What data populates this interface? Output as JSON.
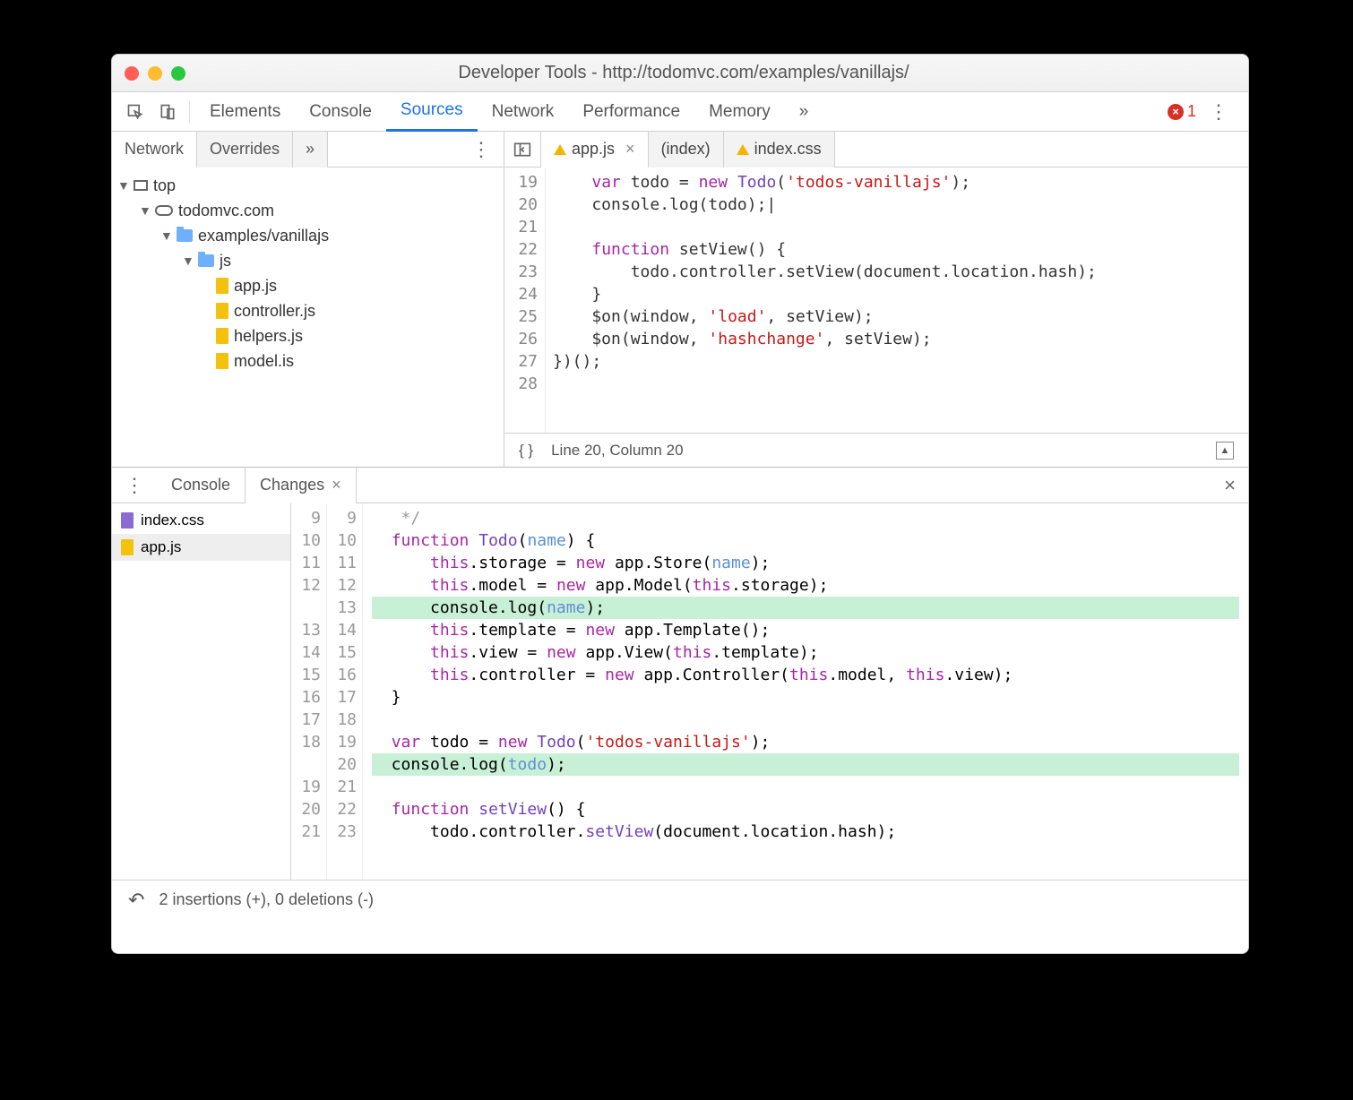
{
  "window": {
    "title": "Developer Tools - http://todomvc.com/examples/vanillajs/"
  },
  "toolbar": {
    "tabs": [
      "Elements",
      "Console",
      "Sources",
      "Network",
      "Performance",
      "Memory"
    ],
    "active": "Sources",
    "overflow": "»",
    "error_count": "1"
  },
  "left_panel": {
    "tabs": {
      "network": "Network",
      "overrides": "Overrides",
      "overflow": "»"
    },
    "tree": {
      "top": "top",
      "domain": "todomvc.com",
      "path": "examples/vanillajs",
      "js_folder": "js",
      "files": [
        "app.js",
        "controller.js",
        "helpers.js",
        "model.is"
      ]
    }
  },
  "editor": {
    "tabs": [
      {
        "name": "app.js",
        "warn": true,
        "close": true,
        "active": true
      },
      {
        "name": "(index)",
        "warn": false,
        "close": false,
        "active": false
      },
      {
        "name": "index.css",
        "warn": true,
        "close": false,
        "active": false
      }
    ],
    "lines": {
      "start": 19,
      "rows": [
        "    var todo = new Todo('todos-vanillajs');",
        "    console.log(todo);|",
        "",
        "    function setView() {",
        "        todo.controller.setView(document.location.hash);",
        "    }",
        "    $on(window, 'load', setView);",
        "    $on(window, 'hashchange', setView);",
        "})();",
        ""
      ]
    },
    "status": {
      "pretty": "{ }",
      "pos": "Line 20, Column 20"
    }
  },
  "drawer": {
    "tabs": {
      "console": "Console",
      "changes": "Changes"
    },
    "files": [
      {
        "name": "index.css",
        "type": "css"
      },
      {
        "name": "app.js",
        "type": "js",
        "selected": true
      }
    ],
    "diff": {
      "old_start": 9,
      "new_start": 9,
      "rows": [
        {
          "o": "9",
          "n": "9",
          "t": "   */",
          "added": false
        },
        {
          "o": "10",
          "n": "10",
          "t": "  function Todo(name) {",
          "added": false
        },
        {
          "o": "11",
          "n": "11",
          "t": "      this.storage = new app.Store(name);",
          "added": false
        },
        {
          "o": "12",
          "n": "12",
          "t": "      this.model = new app.Model(this.storage);",
          "added": false
        },
        {
          "o": "",
          "n": "13",
          "t": "      console.log(name);",
          "added": true
        },
        {
          "o": "13",
          "n": "14",
          "t": "      this.template = new app.Template();",
          "added": false
        },
        {
          "o": "14",
          "n": "15",
          "t": "      this.view = new app.View(this.template);",
          "added": false
        },
        {
          "o": "15",
          "n": "16",
          "t": "      this.controller = new app.Controller(this.model, this.view);",
          "added": false
        },
        {
          "o": "16",
          "n": "17",
          "t": "  }",
          "added": false
        },
        {
          "o": "17",
          "n": "18",
          "t": "",
          "added": false
        },
        {
          "o": "18",
          "n": "19",
          "t": "  var todo = new Todo('todos-vanillajs');",
          "added": false
        },
        {
          "o": "",
          "n": "20",
          "t": "  console.log(todo);",
          "added": true
        },
        {
          "o": "19",
          "n": "21",
          "t": "",
          "added": false
        },
        {
          "o": "20",
          "n": "22",
          "t": "  function setView() {",
          "added": false
        },
        {
          "o": "21",
          "n": "23",
          "t": "      todo.controller.setView(document.location.hash);",
          "added": false
        }
      ]
    },
    "status": "2 insertions (+), 0 deletions (-)"
  }
}
